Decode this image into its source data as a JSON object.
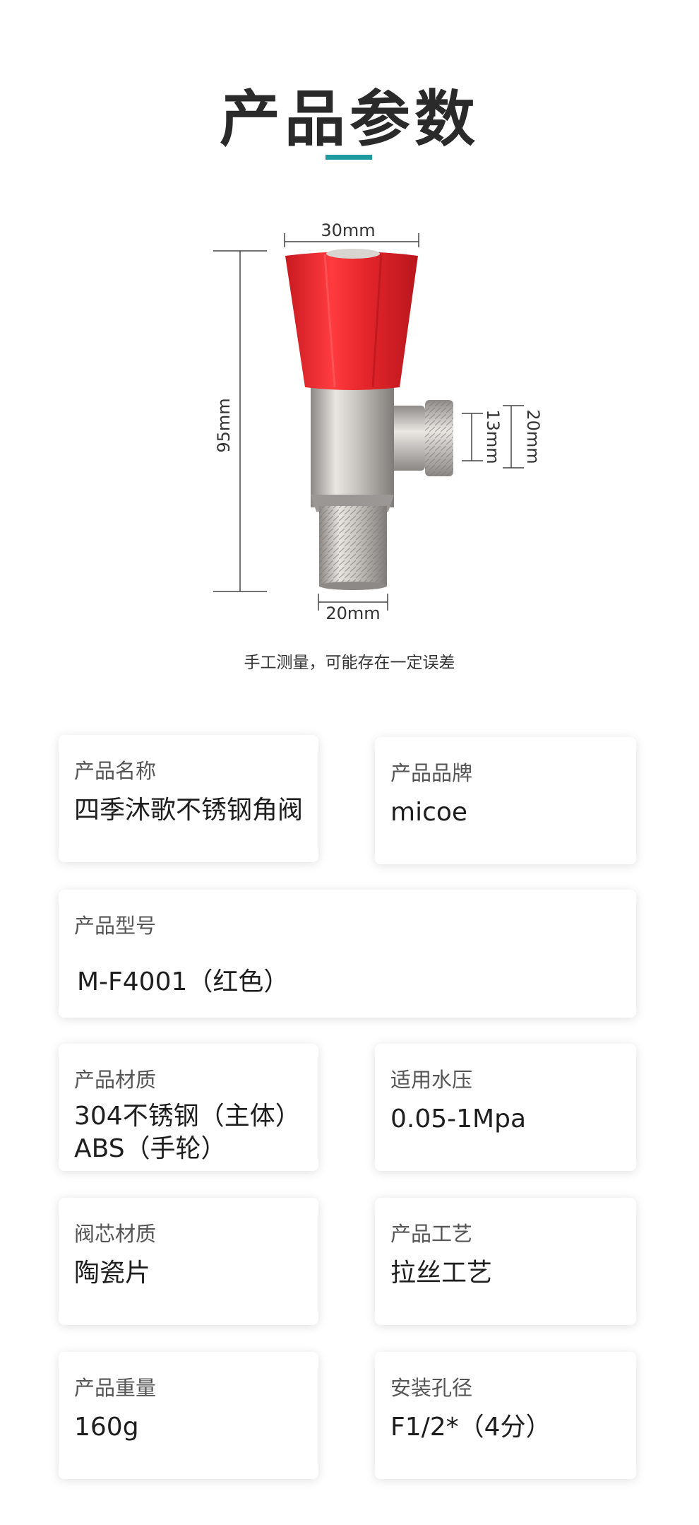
{
  "title": "产品参数",
  "diagram": {
    "dim_top_width": "30mm",
    "dim_height": "95mm",
    "dim_inner_outlet": "13mm",
    "dim_outer_outlet": "20mm",
    "dim_bottom_width": "20mm"
  },
  "note": "手工测量，可能存在一定误差",
  "colors": {
    "accent": "#1f9aa0",
    "handle": "#e8262c"
  },
  "specs": [
    {
      "label": "产品名称",
      "value": "四季沐歌不锈钢角阀"
    },
    {
      "label": "产品品牌",
      "value": "micoe"
    },
    {
      "label": "产品型号",
      "value": "M-F4001（红色）"
    },
    {
      "label": "产品材质",
      "value_line1": "304不锈钢（主体）",
      "value_line2": "ABS（手轮）"
    },
    {
      "label": "适用水压",
      "value": "0.05-1Mpa"
    },
    {
      "label": "阀芯材质",
      "value": "陶瓷片"
    },
    {
      "label": "产品工艺",
      "value": "拉丝工艺"
    },
    {
      "label": "产品重量",
      "value": "160g"
    },
    {
      "label": "安装孔径",
      "value": "F1/2*（4分）"
    }
  ]
}
